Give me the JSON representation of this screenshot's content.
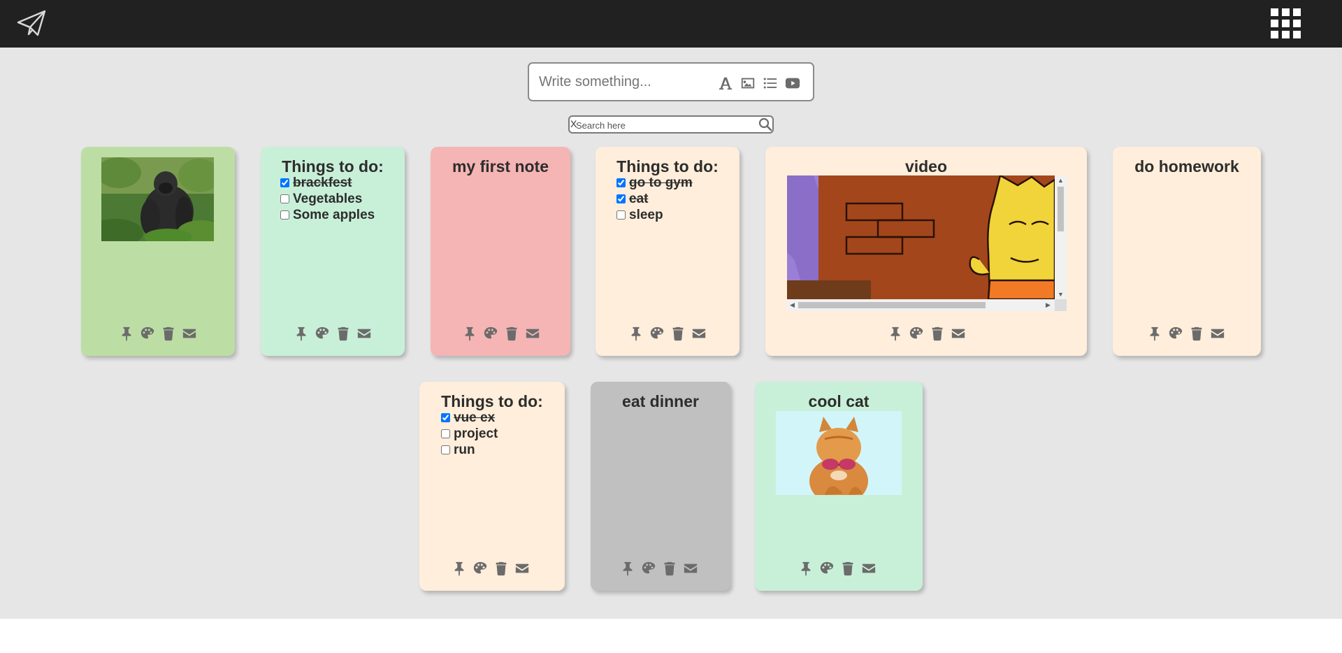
{
  "header": {
    "logo_icon": "paper-plane-icon",
    "apps_icon": "grid-menu-icon"
  },
  "composer": {
    "placeholder": "Write something...",
    "tools": [
      "text-font-icon",
      "image-icon",
      "list-icon",
      "video-icon"
    ]
  },
  "search": {
    "clear_label": "X",
    "placeholder": "Search here"
  },
  "notes": [
    {
      "type": "image",
      "color": "#bcdea4",
      "image": "gorilla"
    },
    {
      "type": "todo",
      "color": "#c8f0d8",
      "title": "Things to do:",
      "items": [
        {
          "text": "brackfest",
          "done": true
        },
        {
          "text": "Vegetables",
          "done": false
        },
        {
          "text": "Some apples",
          "done": false
        }
      ]
    },
    {
      "type": "text",
      "color": "#f5b5b4",
      "title": "my first note"
    },
    {
      "type": "todo",
      "color": "#ffeedb",
      "title": "Things to do:",
      "items": [
        {
          "text": "go to gym",
          "done": true
        },
        {
          "text": "eat",
          "done": true
        },
        {
          "text": "sleep",
          "done": false
        }
      ]
    },
    {
      "type": "video",
      "color": "#ffeedb",
      "title": "video"
    },
    {
      "type": "text",
      "color": "#ffeedb",
      "title": "do homework"
    },
    {
      "type": "todo",
      "color": "#ffeedb",
      "title": "Things to do:",
      "items": [
        {
          "text": "vue ex",
          "done": true
        },
        {
          "text": "project",
          "done": false
        },
        {
          "text": "run",
          "done": false
        }
      ]
    },
    {
      "type": "text",
      "color": "#c0c0c0",
      "title": "eat dinner"
    },
    {
      "type": "image",
      "color": "#c8f0d8",
      "title": "cool cat",
      "image": "cat"
    }
  ],
  "note_actions": [
    "pin-icon",
    "palette-icon",
    "trash-icon",
    "envelope-icon"
  ],
  "colors": {
    "topbar": "#212121",
    "background": "#e6e6e6",
    "icon": "#6b6b6b"
  }
}
